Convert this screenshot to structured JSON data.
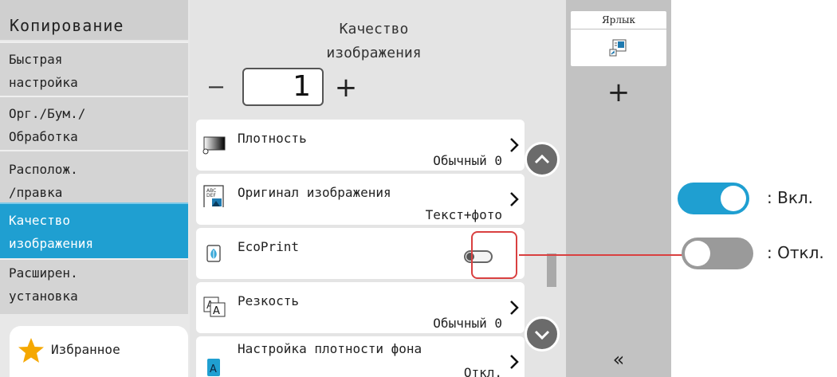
{
  "sidebar": {
    "title": "Копирование",
    "items": [
      {
        "label": "Быстрая\nнастройка"
      },
      {
        "label": "Орг./Бум./\nОбработка"
      },
      {
        "label": "Располож.\n/правка"
      },
      {
        "label": "Качество\nизображения",
        "active": true
      },
      {
        "label": "Расширен.\nустановка"
      }
    ],
    "favorites_label": "Избранное"
  },
  "main": {
    "title": "Качество\nизображения",
    "copies_value": "1",
    "minus_symbol": "—",
    "plus_symbol": "+",
    "rows": [
      {
        "label": "Плотность",
        "value": "Обычный 0",
        "icon": "density-icon"
      },
      {
        "label": "Оригинал изображения",
        "value": "Текст+фото",
        "icon": "original-image-icon"
      },
      {
        "label": "EcoPrint",
        "value": "",
        "icon": "ecoprint-leaf-icon",
        "toggle_state": "off"
      },
      {
        "label": "Резкость",
        "value": "Обычный 0",
        "icon": "sharpness-icon"
      },
      {
        "label": "Настройка плотности фона",
        "value": "Откл.",
        "icon": "background-density-icon"
      }
    ]
  },
  "right_panel": {
    "shortcut_label": "Ярлык",
    "add_symbol": "+",
    "collapse_symbol": "«"
  },
  "legend": {
    "on_label": ": Вкл.",
    "off_label": ": Откл."
  },
  "colors": {
    "accent": "#1f9fd1",
    "highlight": "#d94040",
    "toggle_off": "#9a9a9a"
  }
}
